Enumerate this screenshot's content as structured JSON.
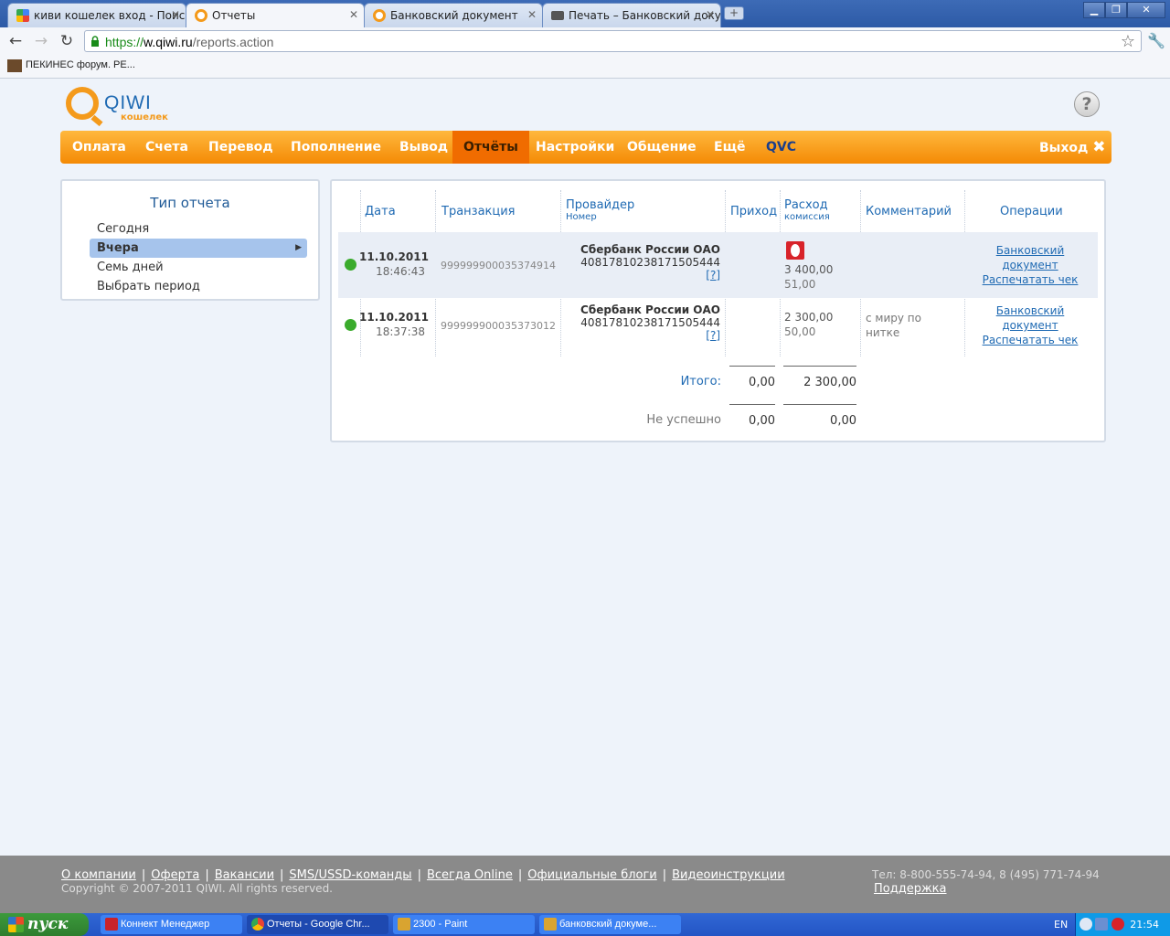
{
  "browser": {
    "tabs": [
      {
        "label": "киви кошелек вход - Поиск в",
        "icon": "google-icon"
      },
      {
        "label": "Отчеты",
        "icon": "qiwi-icon"
      },
      {
        "label": "Банковский документ",
        "icon": "qiwi-icon"
      },
      {
        "label": "Печать – Банковский докуме",
        "icon": "print-icon"
      }
    ],
    "new_tab": "+",
    "url_scheme": "https://",
    "url_host": "w.qiwi.ru",
    "url_path": "/reports.action",
    "bookmark": "ПЕКИНЕС форум. РЕ..."
  },
  "site": {
    "logo_text": "QIWI",
    "logo_sub": "кошелек",
    "help_label": "?",
    "menu": [
      {
        "label": "Оплата"
      },
      {
        "label": "Счета"
      },
      {
        "label": "Перевод"
      },
      {
        "label": "Пополнение"
      },
      {
        "label": "Вывод"
      },
      {
        "label": "Отчёты"
      },
      {
        "label": "Настройки"
      },
      {
        "label": "Общение"
      },
      {
        "label": "Ещё"
      },
      {
        "label": "QVC"
      }
    ],
    "exit_label": "Выход"
  },
  "report_type": {
    "title": "Тип отчета",
    "options": [
      "Сегодня",
      "Вчера",
      "Семь дней",
      "Выбрать период"
    ],
    "selected": "Вчера"
  },
  "table": {
    "headers": {
      "date": "Дата",
      "txn": "Транзакция",
      "provider": "Провайдер",
      "provider_sub": "Номер",
      "income": "Приход",
      "expense": "Расход",
      "expense_sub": "комиссия",
      "comment": "Комментарий",
      "ops": "Операции"
    },
    "rows": [
      {
        "date": "11.10.2011",
        "time": "18:46:43",
        "txn": "999999900035374914",
        "provider": "Сбербанк России ОАО",
        "number": "40817810238171505444",
        "qlink": "[?]",
        "expense": "3 400,00",
        "commission": "51,00",
        "comment_1": "",
        "comment_2": "",
        "op_doc_1": "Банковский",
        "op_doc_2": "документ",
        "op_print": "Распечатать чек"
      },
      {
        "date": "11.10.2011",
        "time": "18:37:38",
        "txn": "999999900035373012",
        "provider": "Сбербанк России ОАО",
        "number": "40817810238171505444",
        "qlink": "[?]",
        "expense": "2 300,00",
        "commission": "50,00",
        "comment_1": "с миру по",
        "comment_2": "нитке",
        "op_doc_1": "Банковский",
        "op_doc_2": "документ",
        "op_print": "Распечатать чек"
      }
    ],
    "total_label": "Итого:",
    "total_income": "0,00",
    "total_expense": "2 300,00",
    "failed_label": "Не успешно",
    "failed_income": "0,00",
    "failed_expense": "0,00"
  },
  "footer": {
    "links": [
      "О компании",
      "Оферта",
      "Вакансии",
      "SMS/USSD-команды",
      "Всегда Online",
      "Официальные блоги",
      "Видеоинструкции"
    ],
    "copyright": "Copyright © 2007-2011 QIWI. All rights reserved.",
    "contact": "Тел: 8-800-555-74-94, 8 (495) 771-74-94",
    "support": "Поддержка"
  },
  "taskbar": {
    "start": "пуск",
    "items": [
      "Коннект Менеджер",
      "Отчеты - Google Chr...",
      "2300 - Paint",
      "банковский докуме..."
    ],
    "lang": "EN",
    "clock": "21:54"
  }
}
